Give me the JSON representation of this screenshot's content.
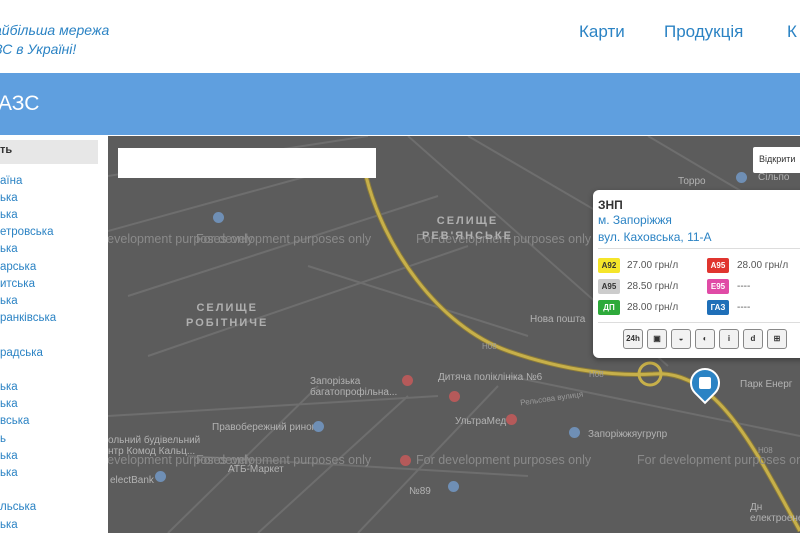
{
  "header": {
    "slogan_line1": "айбільша мережа",
    "slogan_line2": "ЗС в Україні!",
    "nav": [
      "Карти",
      "Продукція",
      "К"
    ]
  },
  "bar": {
    "title": "АЗС"
  },
  "sidebar": {
    "header": "ть",
    "regions": [
      "аїна",
      "ька",
      "ька",
      "етровська",
      "ька",
      "арська",
      "итська",
      "ька",
      "ранківська",
      "",
      "радська",
      "",
      "ька",
      "ька",
      "вська",
      "ь",
      "ька",
      "ька",
      "",
      "льська",
      "ька"
    ]
  },
  "map": {
    "search_placeholder": "",
    "open_button": "Відкрити",
    "dev_watermark": "For development purposes only",
    "districts": [
      "СЕЛИЩЕ\nРЕВ'ЯНСЬКЕ",
      "СЕЛИЩЕ\nРОБІТНИЧЕ"
    ],
    "pois": [
      "Торро",
      "Сільпо",
      "Нова пошта",
      "Парк Енерг",
      "Запорізька\nбагатопрофільна...",
      "Дитяча поліклініка №6",
      "Правобережний ринок",
      "УльтраМед",
      "Запоріжжяугрупр",
      "АТБ-Маркет",
      "№89",
      "electBank",
      "ольний будівельний\nнтр Комод Кальц...",
      "Дн\nелектроенерге..."
    ],
    "streets": [
      "Н08",
      "Н08",
      "Н08",
      "Рельсова вулиця"
    ]
  },
  "popup": {
    "name": "ЗНП",
    "city": "м. Запоріжжя",
    "address": "вул. Каховська, 11-А",
    "fuels": [
      {
        "label": "A92",
        "price": "27.00 грн/л",
        "color": "#f5e52a",
        "text_color": "#333333"
      },
      {
        "label": "A95",
        "price": "28.00 грн/л",
        "color": "#e0352f",
        "text_color": "#ffffff"
      },
      {
        "label": "A95",
        "price": "28.50 грн/л",
        "color": "#cccccc",
        "text_color": "#333333"
      },
      {
        "label": "E95",
        "price": "----",
        "color": "#e04ba6",
        "text_color": "#ffffff"
      },
      {
        "label": "ДП",
        "price": "28.00 грн/л",
        "color": "#2daa3a",
        "text_color": "#ffffff"
      },
      {
        "label": "ГАЗ",
        "price": "----",
        "color": "#1f6fb8",
        "text_color": "#ffffff"
      }
    ],
    "services": [
      "24h",
      "car-wash-icon",
      "oil-icon",
      "tire-icon",
      "info-icon",
      "shop-icon",
      "gallery-icon"
    ],
    "service_glyphs": [
      "24h",
      "▣",
      "◒",
      "◐",
      "i",
      "d",
      "⊞"
    ]
  }
}
